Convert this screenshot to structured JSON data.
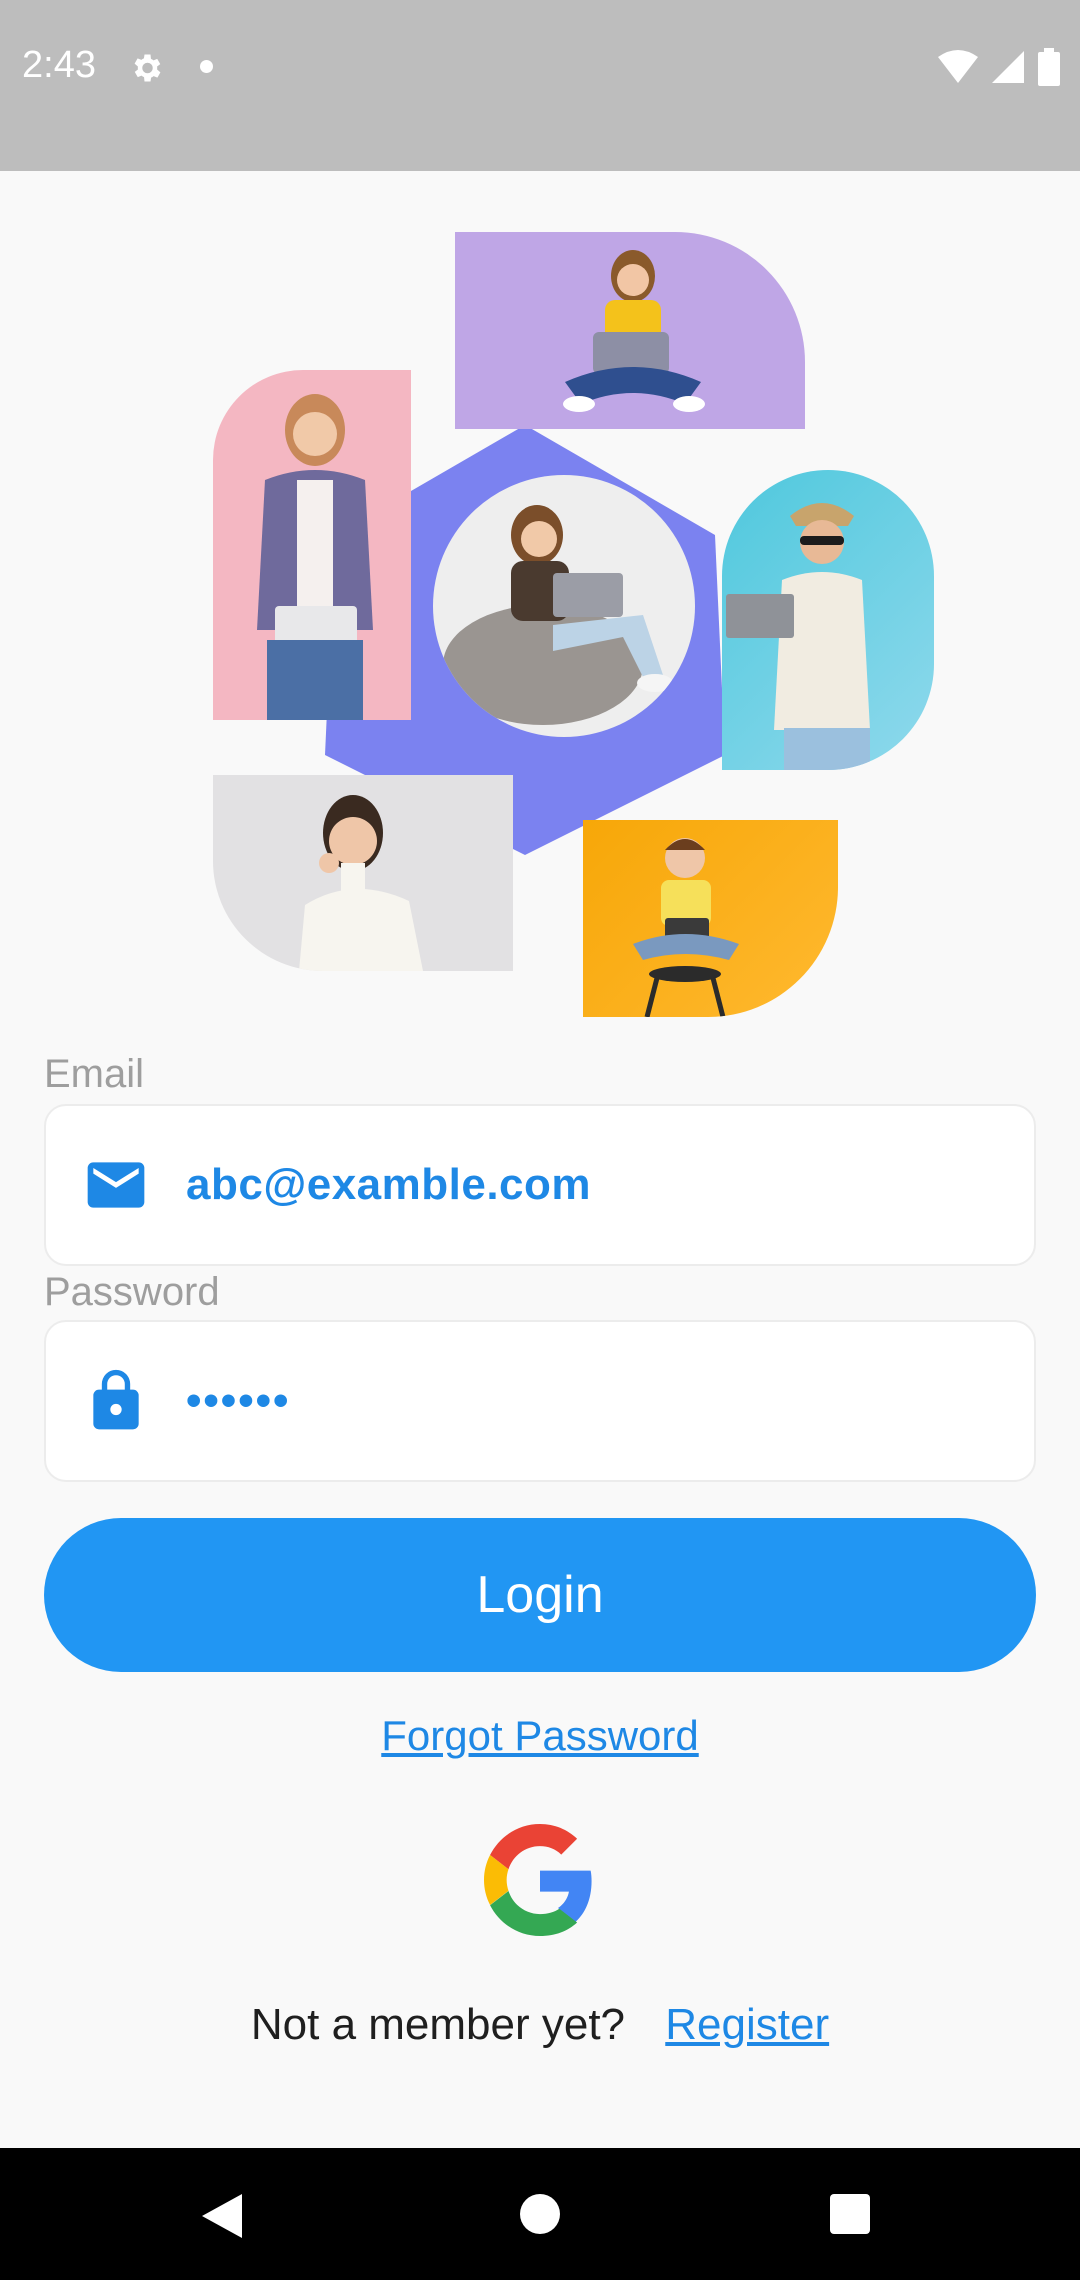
{
  "status_bar": {
    "time": "2:43",
    "icons": [
      "settings-icon",
      "notification-dot-icon",
      "wifi-icon",
      "signal-icon",
      "battery-icon"
    ]
  },
  "hero": {
    "photos": [
      "pink-woman-photo",
      "purple-girl-photo",
      "beanbag-woman-photo",
      "cyan-man-photo",
      "gray-woman-photo",
      "orange-boy-photo"
    ]
  },
  "form": {
    "email_label": "Email",
    "email_value": "abc@examble.com",
    "password_label": "Password",
    "password_value": "••••••"
  },
  "actions": {
    "login_label": "Login",
    "forgot_label": "Forgot Password",
    "not_member_text": "Not a member yet?",
    "register_label": "Register"
  },
  "colors": {
    "accent": "#2196f3",
    "link": "#1e88e5",
    "hex_shape": "#7b82f0",
    "status_bar": "#bdbdbd",
    "background": "#f9f9f9"
  }
}
